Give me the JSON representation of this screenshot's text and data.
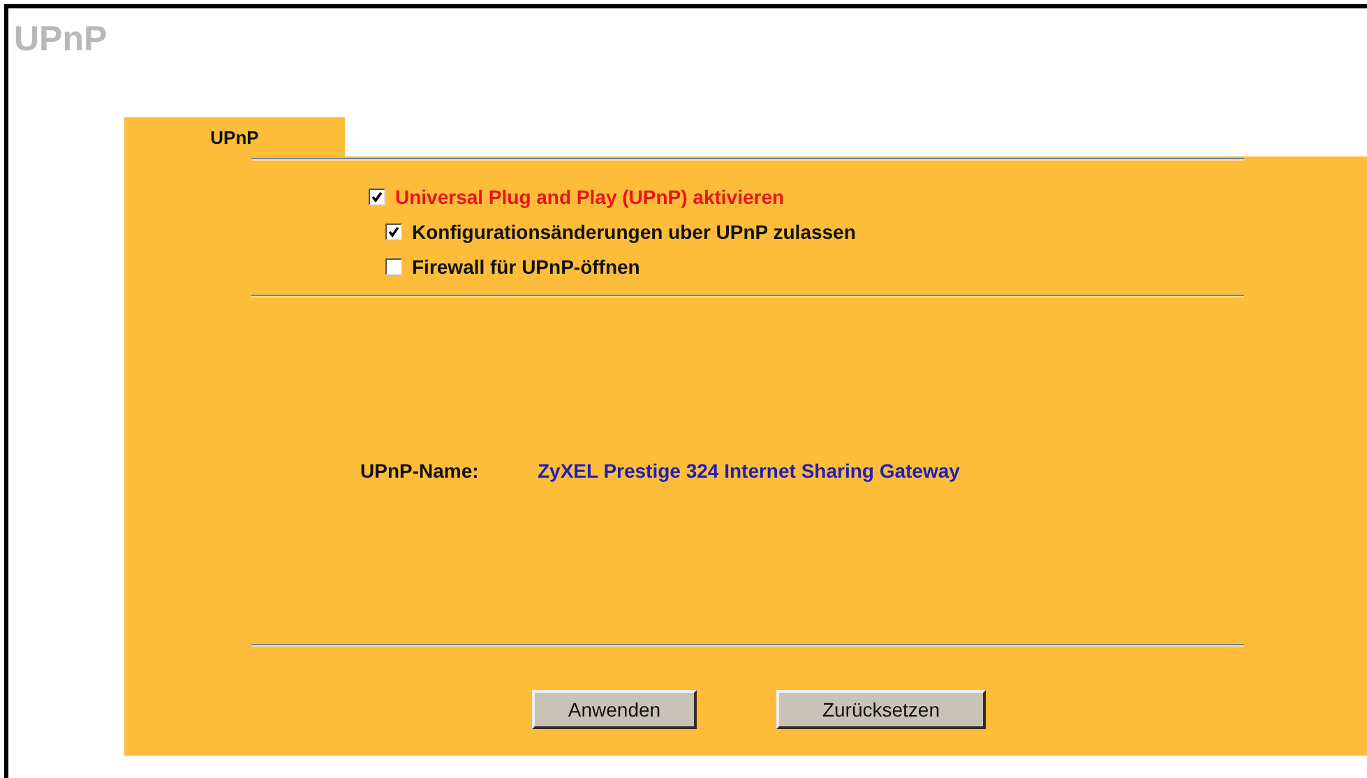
{
  "page_title": "UPnP",
  "tabs": [
    {
      "label": "UPnP",
      "selected": true
    }
  ],
  "options": [
    {
      "label": "Universal Plug and Play (UPnP) aktivieren",
      "checked": true,
      "children": [
        {
          "label": "Konfigurationsänderungen uber UPnP zulassen",
          "checked": true
        },
        {
          "label": "Firewall für UPnP-öffnen",
          "checked": false
        }
      ]
    }
  ],
  "upnp_name": {
    "label": "UPnP-Name:",
    "value": "ZyXEL Prestige 324 Internet Sharing Gateway"
  },
  "buttons": [
    "Anwenden",
    "Zurücksetzen"
  ]
}
